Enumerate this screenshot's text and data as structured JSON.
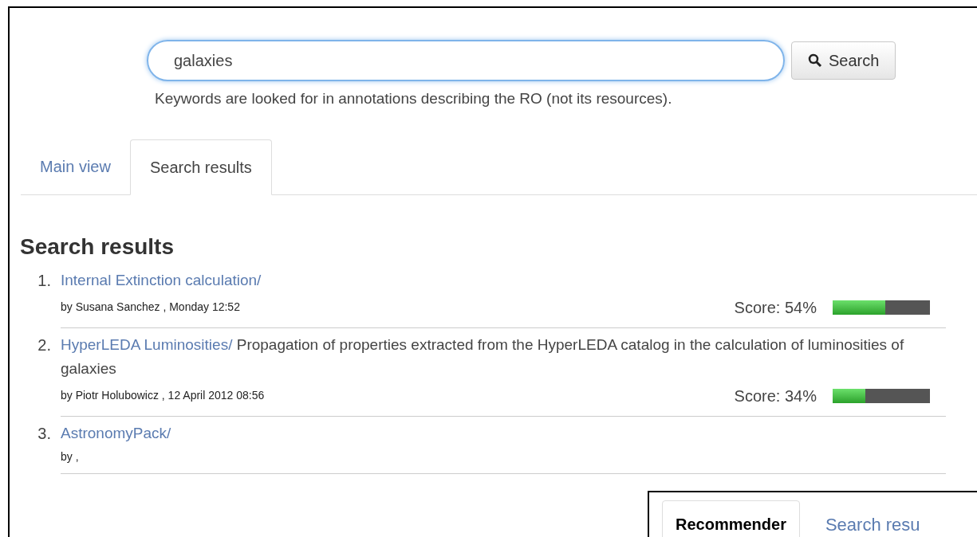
{
  "search": {
    "value": "galaxies",
    "button": "Search",
    "hint": "Keywords are looked for in annotations describing the RO (not its resources)."
  },
  "tabs": [
    {
      "label": "Main view",
      "selected": false
    },
    {
      "label": "Search results",
      "selected": true
    }
  ],
  "heading": "Search results",
  "results": [
    {
      "number": "1.",
      "title": "Internal Extinction calculation/",
      "meta": "by Susana Sanchez , Monday 12:52",
      "score": "Score: 54%",
      "level": 0.54
    },
    {
      "number": "2.",
      "title": "HyperLEDA Luminosities/",
      "description": "Propagation of properties extracted from the HyperLEDA catalog in the calculation of luminosities of galaxies",
      "meta": "by Piotr Holubowicz , 12 April 2012 08:56",
      "score": "Score: 34%",
      "level": 0.34
    },
    {
      "number": "3.",
      "title": "AstronomyPack/",
      "meta": "by ,"
    }
  ],
  "inset": {
    "tabs": [
      {
        "label": "Recommender",
        "selected": true
      },
      {
        "label": "Search resu",
        "selected": false
      }
    ]
  }
}
